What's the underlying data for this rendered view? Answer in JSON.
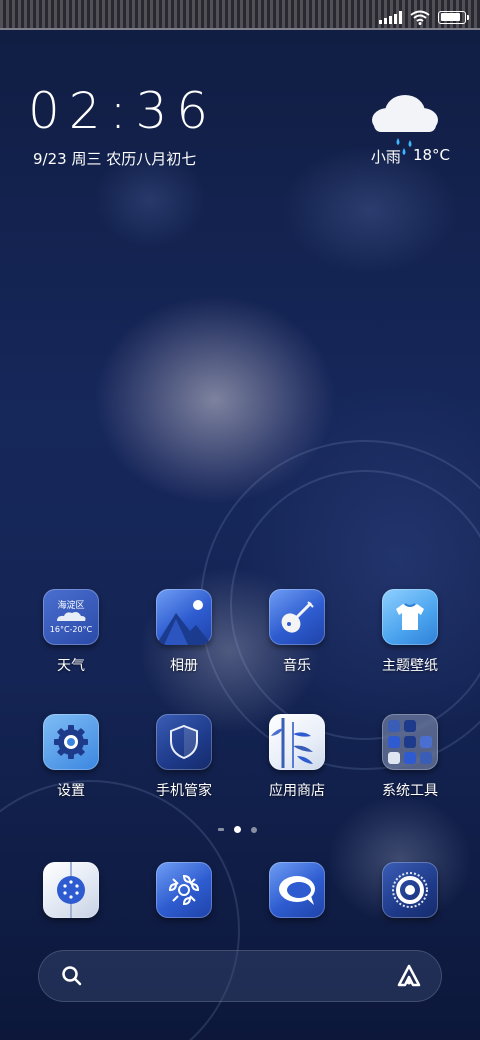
{
  "status_bar": {
    "signal_icon": "signal-icon",
    "wifi_icon": "wifi-icon",
    "battery_icon": "battery-icon",
    "battery_level": 0.85
  },
  "clock": {
    "time": "02:36",
    "date": "9/23 周三 农历八月初七"
  },
  "weather": {
    "icon": "rain-cloud-icon",
    "condition": "小雨",
    "temperature": "18°C"
  },
  "apps_row1": [
    {
      "label": "天气",
      "icon": "weather-icon",
      "widget_city": "海淀区",
      "widget_range": "16°C-20°C"
    },
    {
      "label": "相册",
      "icon": "gallery-icon"
    },
    {
      "label": "音乐",
      "icon": "music-pipa-icon"
    },
    {
      "label": "主题壁纸",
      "icon": "theme-tshirt-icon"
    }
  ],
  "apps_row2": [
    {
      "label": "设置",
      "icon": "settings-gear-icon"
    },
    {
      "label": "手机管家",
      "icon": "security-shield-icon"
    },
    {
      "label": "应用商店",
      "icon": "app-store-bamboo-icon"
    },
    {
      "label": "系统工具",
      "icon": "system-tools-folder-icon"
    }
  ],
  "page_indicator": {
    "pages": 3,
    "current": 1
  },
  "dock": [
    {
      "icon": "phone-dial-icon"
    },
    {
      "icon": "contacts-ornament-icon"
    },
    {
      "icon": "messages-bubble-icon"
    },
    {
      "icon": "browser-ring-icon"
    }
  ],
  "search_bar": {
    "search_icon": "search-icon",
    "assistant_icon": "assistant-icon"
  }
}
